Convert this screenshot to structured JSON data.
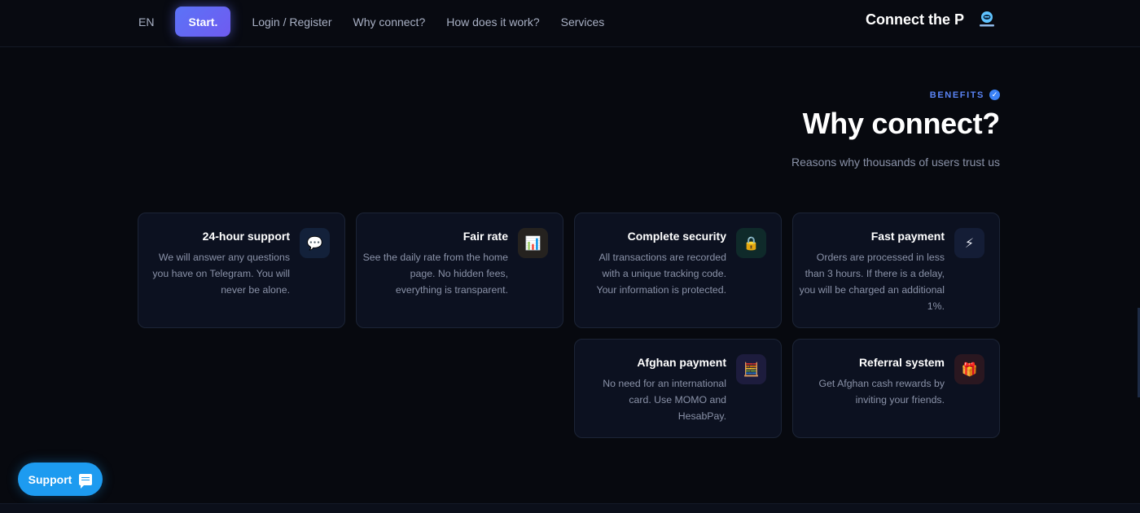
{
  "nav": {
    "lang": "EN",
    "start_label": "Start.",
    "links": [
      "Login / Register",
      "Why connect?",
      "How does it work?",
      "Services"
    ]
  },
  "brand": {
    "title": "Connect the P",
    "logo_icon": "brand-logo-icon"
  },
  "section": {
    "eyebrow": "BENEFITS",
    "headline": "Why connect?",
    "subhead": "Reasons why thousands of users trust us"
  },
  "cards": [
    {
      "title": "24-hour support",
      "desc": "We will answer any questions you have on Telegram. You will never be alone.",
      "icon": "💬",
      "icon_name": "speech-bubble-icon",
      "icon_bg": "#13213a"
    },
    {
      "title": "Fair rate",
      "desc": "See the daily rate from the home page. No hidden fees, everything is transparent.",
      "icon": "📊",
      "icon_name": "bar-chart-icon",
      "icon_bg": "#25221f"
    },
    {
      "title": "Complete security",
      "desc": "All transactions are recorded with a unique tracking code. Your information is protected.",
      "icon": "🔒",
      "icon_name": "lock-icon",
      "icon_bg": "#0f2a2a"
    },
    {
      "title": "Fast payment",
      "desc": "Orders are processed in less than 3 hours. If there is a delay, you will be charged an additional 1%.",
      "icon": "⚡",
      "icon_name": "lightning-icon",
      "icon_bg": "#141d36"
    },
    {
      "title": "Afghan payment",
      "desc": "No need for an international card. Use MOMO and HesabPay.",
      "icon": "🧮",
      "icon_name": "calculator-icon",
      "icon_bg": "#1d1c3d"
    },
    {
      "title": "Referral system",
      "desc": "Get Afghan cash rewards by inviting your friends.",
      "icon": "🎁",
      "icon_name": "gift-icon",
      "icon_bg": "#2a1720"
    }
  ],
  "support": {
    "label": "Support"
  }
}
